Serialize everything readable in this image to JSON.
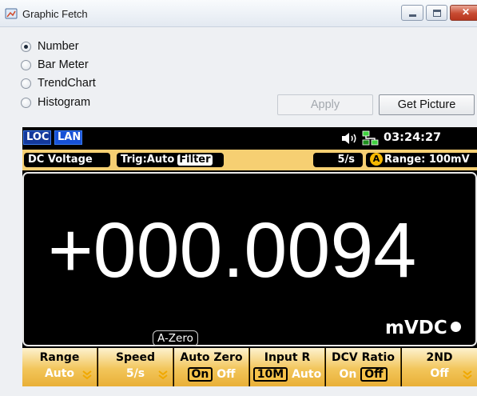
{
  "window": {
    "title": "Graphic Fetch"
  },
  "display_modes": {
    "options": [
      "Number",
      "Bar Meter",
      "TrendChart",
      "Histogram"
    ],
    "selected": "Number"
  },
  "buttons": {
    "apply": "Apply",
    "get_picture": "Get Picture"
  },
  "instrument": {
    "status": {
      "loc": "LOC",
      "lan": "LAN",
      "time": "03:24:27"
    },
    "info": {
      "function": "DC Voltage",
      "trigger": "Trig:Auto",
      "filter": "Filter",
      "rate": "5/s",
      "auto_badge": "A",
      "range": "Range: 100mV"
    },
    "reading": "+000.0094",
    "azero_label": "A-Zero",
    "unit": "mVDC",
    "softkeys": [
      {
        "title": "Range",
        "value": "Auto"
      },
      {
        "title": "Speed",
        "value": "5/s"
      },
      {
        "title": "Auto Zero",
        "on": "On",
        "off": "Off"
      },
      {
        "title": "Input R",
        "on": "10M",
        "off": "Auto"
      },
      {
        "title": "DCV Ratio",
        "on": "On",
        "off": "Off"
      },
      {
        "title": "2ND",
        "value": "Off"
      }
    ]
  },
  "colors": {
    "softkey_amber": "#f2c55a",
    "info_bar": "#f6cf72",
    "lan_blue": "#1751d6"
  }
}
